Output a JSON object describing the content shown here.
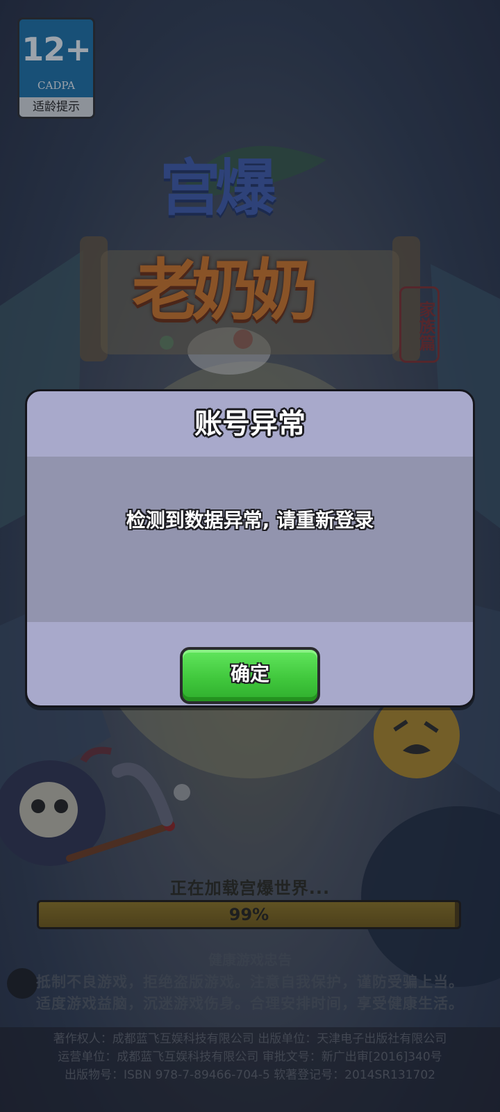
{
  "age_rating": {
    "number": "12+",
    "org": "CADPA",
    "label": "适龄提示"
  },
  "logo": {
    "top_text": "宫爆",
    "main_text": "老奶奶",
    "seal_text": "家族篇"
  },
  "loading": {
    "text": "正在加载宫爆世界...",
    "percent_label": "99%",
    "progress": 0.99
  },
  "advisory": {
    "title": "健康游戏忠告",
    "lines": [
      "抵制不良游戏，拒绝盗版游戏。注意自我保护，谨防受骗上当。",
      "适度游戏益脑，沉迷游戏伤身。合理安排时间，享受健康生活。"
    ]
  },
  "copyright": {
    "lines": [
      "著作权人：成都蓝飞互娱科技有限公司  出版单位：天津电子出版社有限公司",
      "运营单位：成都蓝飞互娱科技有限公司  审批文号：新广出审[2016]340号",
      "出版物号：ISBN 978-7-89466-704-5  软著登记号：2014SR131702"
    ]
  },
  "dialog": {
    "title": "账号异常",
    "message": "检测到数据异常, 请重新登录",
    "confirm_label": "确定"
  },
  "colors": {
    "dialog_bg": "#a8a9cb",
    "dialog_body": "#9294ae",
    "confirm_green": "#41c83d",
    "badge_blue": "#1d6fa5"
  }
}
